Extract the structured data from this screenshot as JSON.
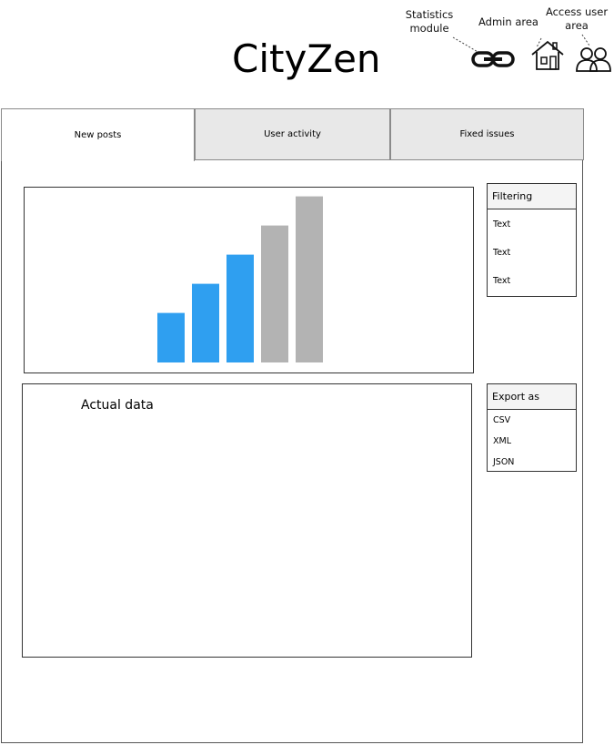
{
  "app": {
    "title": "CityZen"
  },
  "header": {
    "annotations": {
      "statistics": "Statistics module",
      "admin": "Admin area",
      "access": "Access user area"
    },
    "icons": [
      "link-icon",
      "house-icon",
      "users-icon"
    ]
  },
  "tabs": [
    {
      "label": "New posts",
      "active": true
    },
    {
      "label": "User activity",
      "active": false
    },
    {
      "label": "Fixed issues",
      "active": false
    }
  ],
  "chart_data": {
    "type": "bar",
    "values": [
      1.7,
      2.7,
      3.7,
      4.7,
      5.7
    ],
    "colors": [
      "#2f9ff0",
      "#2f9ff0",
      "#2f9ff0",
      "#b3b3b3",
      "#b3b3b3"
    ]
  },
  "main": {
    "data_label": "Actual data"
  },
  "filtering": {
    "heading": "Filtering",
    "items": [
      "Text",
      "Text",
      "Text"
    ]
  },
  "export": {
    "heading": "Export as",
    "items": [
      "CSV",
      "XML",
      "JSON"
    ]
  }
}
